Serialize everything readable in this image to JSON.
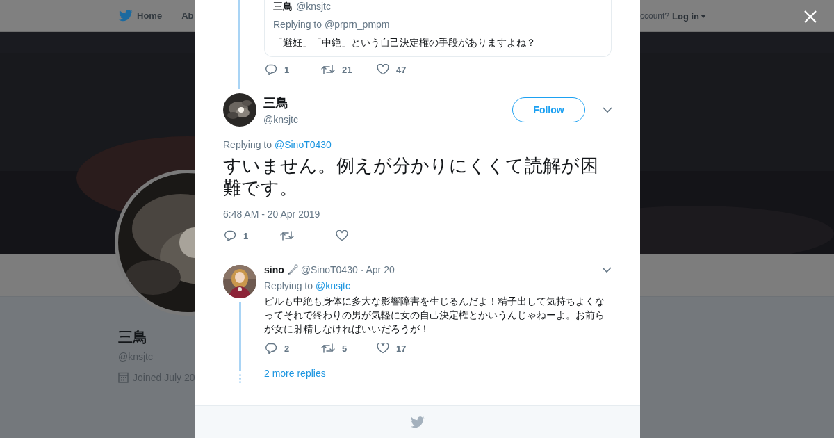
{
  "backdrop": {
    "nav": {
      "home": "Home",
      "about": "Ab",
      "account_prompt": "ccount?",
      "login": "Log in"
    },
    "profile": {
      "name": "三鳥",
      "handle": "@knsjtc",
      "joined": "Joined July 20"
    }
  },
  "quoted_tweet": {
    "name": "三鳥",
    "handle": "@knsjtc",
    "replying": "Replying to @prprn_pmpm",
    "text": "「避妊」「中絶」という自己決定権の手段がありますよね？",
    "actions": [
      {
        "kind": "reply",
        "count": "1"
      },
      {
        "kind": "retweet",
        "count": "21"
      },
      {
        "kind": "like",
        "count": "47"
      }
    ]
  },
  "main_tweet": {
    "name": "三鳥",
    "handle": "@knsjtc",
    "follow": "Follow",
    "replying_label": "Replying to",
    "replying_to": "@SinoT0430",
    "text": "すいません。例えが分かりにくくて読解が困難です。",
    "timestamp": "6:48 AM - 20 Apr 2019",
    "actions": [
      {
        "kind": "reply",
        "count": "1"
      },
      {
        "kind": "retweet"
      },
      {
        "kind": "like"
      }
    ]
  },
  "reply_tweet": {
    "name": "sino",
    "handle": "@SinoT0430",
    "date": "· Apr 20",
    "replying_label": "Replying to",
    "replying_to": "@knsjtc",
    "text": "ピルも中絶も身体に多大な影響障害を生じるんだよ！精子出して気持ちよくなってそれで終わりの男が気軽に女の自己決定権とかいうんじゃねーよ。お前らが女に射精しなければいいだろうが！",
    "actions": [
      {
        "kind": "reply",
        "count": "2"
      },
      {
        "kind": "retweet",
        "count": "5"
      },
      {
        "kind": "like",
        "count": "17"
      }
    ]
  },
  "more_replies": "2 more replies"
}
